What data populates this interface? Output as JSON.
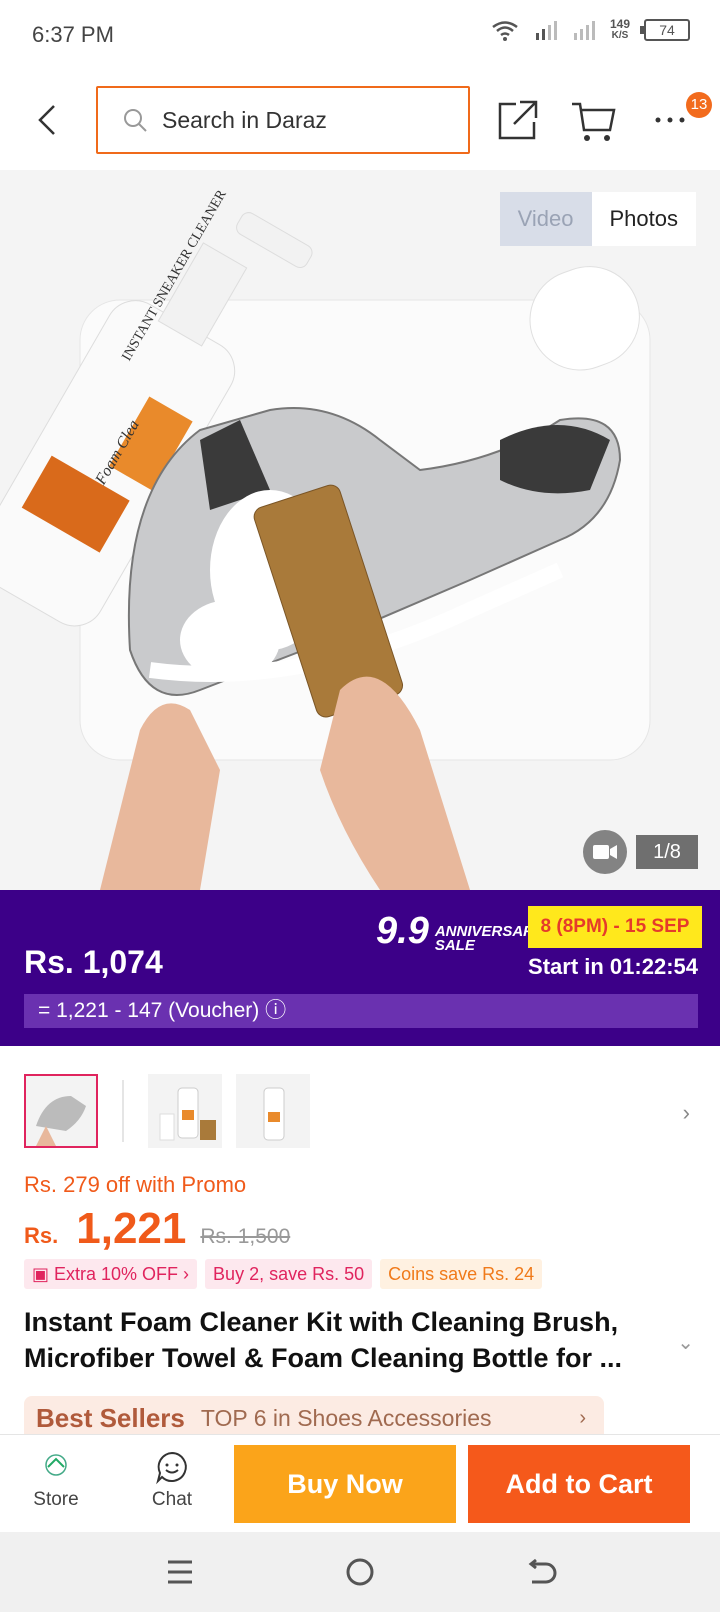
{
  "status": {
    "time": "6:37 PM",
    "net_speed": "149",
    "net_unit": "K/S",
    "battery": "74"
  },
  "header": {
    "search_placeholder": "Search in Daraz",
    "cart_badge": "13"
  },
  "gallery": {
    "tabs": [
      "Video",
      "Photos"
    ],
    "active_tab": "Photos",
    "counter": "1/8",
    "product_label_1": "INSTANT SNEAKER CLEANER",
    "product_label_2": "Foam Clea"
  },
  "promo_banner": {
    "price": "Rs. 1,074",
    "campaign_big": "9.9",
    "campaign_small_1": "ANNIVERSARY",
    "campaign_small_2": "SALE",
    "date": "8 (8PM) - 15 SEP",
    "start": "Start in 01:22:54",
    "voucher": "= 1,221 - 147 (Voucher) ⓘ"
  },
  "product": {
    "promo_text": "Rs. 279 off with Promo",
    "currency": "Rs.",
    "price": "1,221",
    "old_price": "Rs. 1,500",
    "chips": [
      "Extra 10% OFF",
      "Buy 2, save Rs. 50",
      "Coins save Rs. 24"
    ],
    "title": "Instant Foam Cleaner Kit with Cleaning Brush, Microfiber Towel & Foam Cleaning Bottle for ...",
    "best_seller_label": "Best Sellers",
    "best_seller_text": "TOP 6 in Shoes Accessories"
  },
  "actionbar": {
    "store": "Store",
    "chat": "Chat",
    "buy_now": "Buy Now",
    "add_to_cart": "Add to Cart"
  },
  "colors": {
    "accent": "#f5591b",
    "promo_bg": "#3c0088",
    "buy": "#fba41a"
  }
}
